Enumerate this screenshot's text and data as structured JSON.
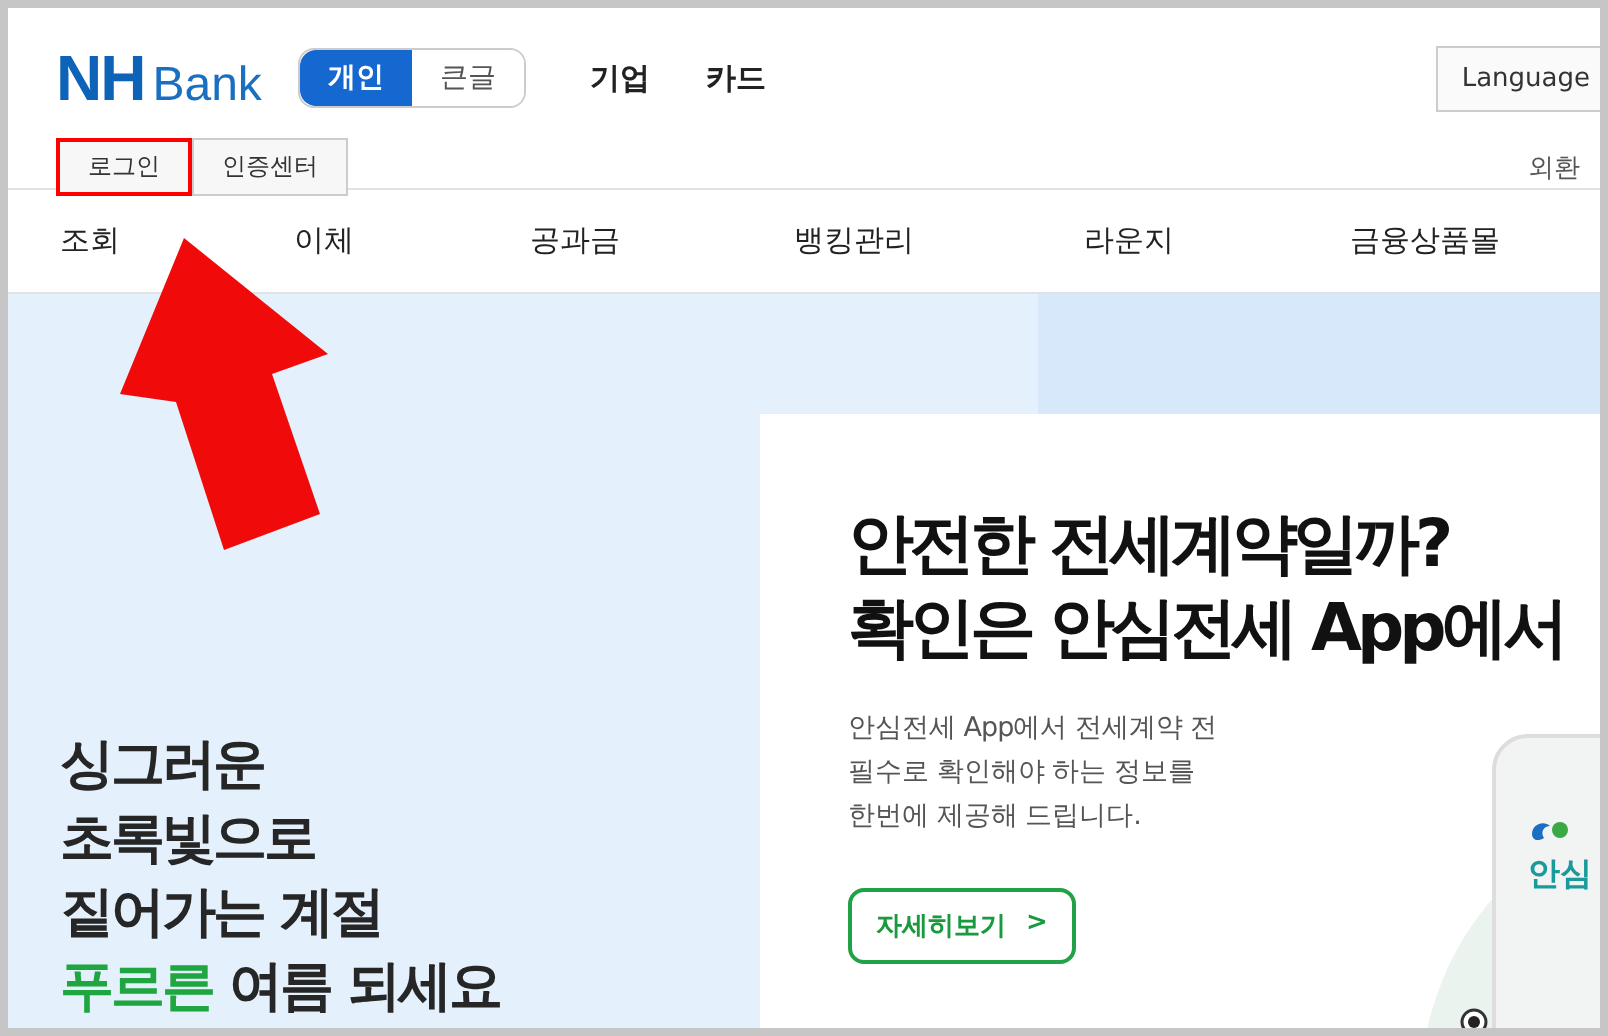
{
  "logo": {
    "mark": "NH",
    "text": "Bank"
  },
  "view_tabs": [
    {
      "label": "개인",
      "selected": true
    },
    {
      "label": "큰글",
      "selected": false
    }
  ],
  "top_links": [
    "기업",
    "카드"
  ],
  "language_button": "Language",
  "account_buttons": [
    {
      "label": "로그인",
      "highlighted": true
    },
    {
      "label": "인증센터",
      "highlighted": false
    }
  ],
  "fx_link": "외환",
  "nav": [
    "조회",
    "이체",
    "공과금",
    "뱅킹관리",
    "라운지",
    "금융상품몰"
  ],
  "promo": {
    "lines": [
      "싱그러운",
      "초록빛으로",
      "짙어가는 계절"
    ],
    "highlight": "푸르른",
    "rest": "여름 되세요"
  },
  "banner": {
    "headline": [
      "안전한 전세계약일까?",
      "확인은 안심전세 App에서"
    ],
    "description": [
      "안심전세 App에서 전세계약 전",
      "필수로 확인해야 하는 정보를",
      "한번에 제공해 드립니다."
    ],
    "button": "자세히보기",
    "button_icon": ">",
    "app_label": "안심"
  }
}
